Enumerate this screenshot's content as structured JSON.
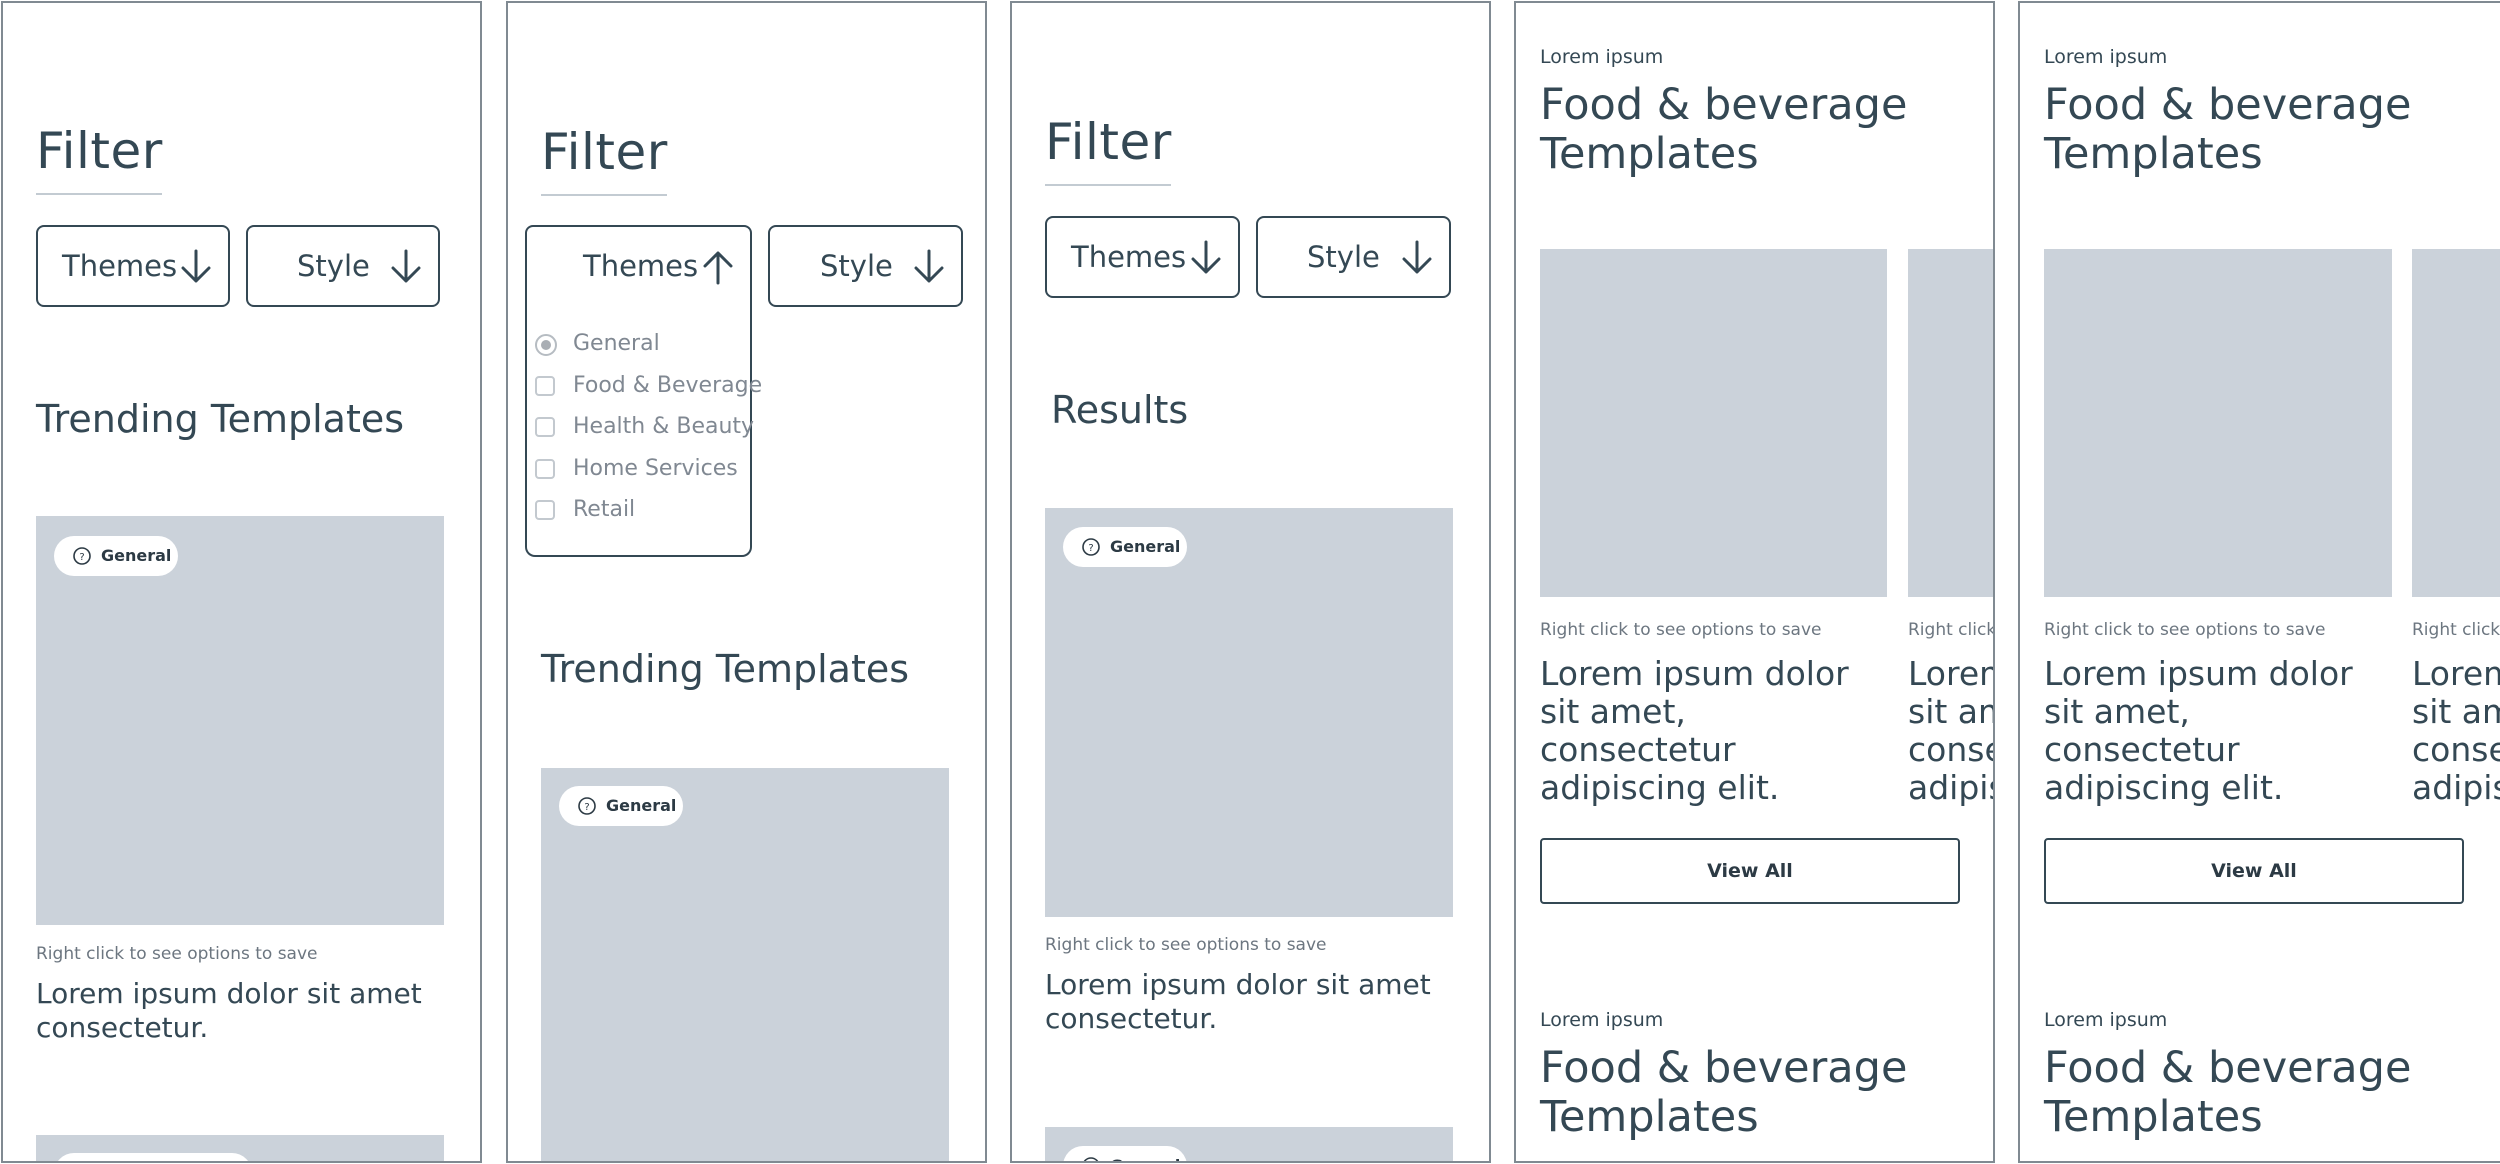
{
  "filter": {
    "title": "Filter",
    "themes_label": "Themes",
    "style_label": "Style"
  },
  "themes_options": [
    {
      "label": "General",
      "selected": true
    },
    {
      "label": "Food & Beverage",
      "selected": false
    },
    {
      "label": "Health & Beauty",
      "selected": false
    },
    {
      "label": "Home Services",
      "selected": false
    },
    {
      "label": "Retail",
      "selected": false
    }
  ],
  "trending": {
    "title": "Trending Templates"
  },
  "results": {
    "title": "Results"
  },
  "card": {
    "chip": "General",
    "hint": "Right click to see options to save",
    "title": "Lorem ipsum dolor sit amet consectetur."
  },
  "category": {
    "eyebrow": "Lorem ipsum",
    "heading": "Food & beverage Templates",
    "card_hint": "Right click to see options to save",
    "card_hint_partial": "Right click",
    "card_title": "Lorem ipsum dolor sit amet, consectetur adipiscing elit.",
    "view_all": "View All"
  },
  "colors": {
    "text": "#344854",
    "placeholder": "#cbd2da",
    "border": "#808a92",
    "muted": "#6c7680"
  },
  "icons": {
    "down": "arrow-down-icon",
    "up": "arrow-up-icon",
    "help": "help-circle-icon"
  }
}
